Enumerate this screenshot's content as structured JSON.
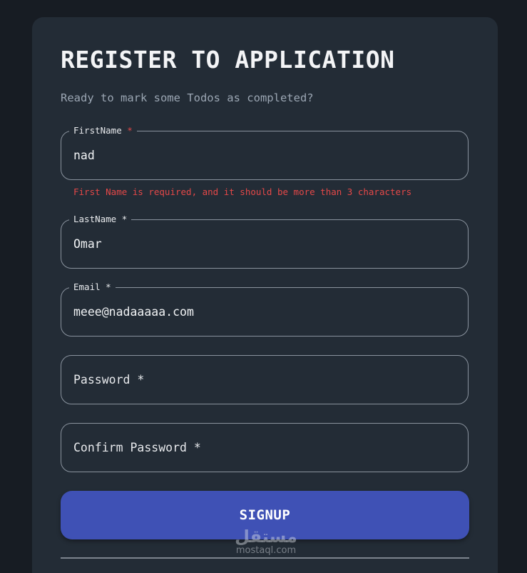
{
  "form": {
    "title": "REGISTER TO APPLICATION",
    "subtitle": "Ready to mark some Todos as completed?",
    "fields": [
      {
        "label": "FirstName",
        "required_mark": "*",
        "value": "nad"
      },
      {
        "label": "LastName",
        "required_mark": "*",
        "value": "Omar"
      },
      {
        "label": "Email",
        "required_mark": "*",
        "value": "meee@nadaaaaa.com"
      },
      {
        "label": "Password *",
        "value": ""
      },
      {
        "label": "Confirm Password *",
        "value": ""
      }
    ],
    "firstname_error": "First Name is required, and it should be more than 3 characters",
    "signup_label": "SIGNUP"
  },
  "watermark": {
    "arabic": "مستقل",
    "latin": "mostaql.com"
  },
  "colors": {
    "background": "#171c23",
    "card": "#232c36",
    "accent": "#3f51b5",
    "error": "#e54848"
  }
}
